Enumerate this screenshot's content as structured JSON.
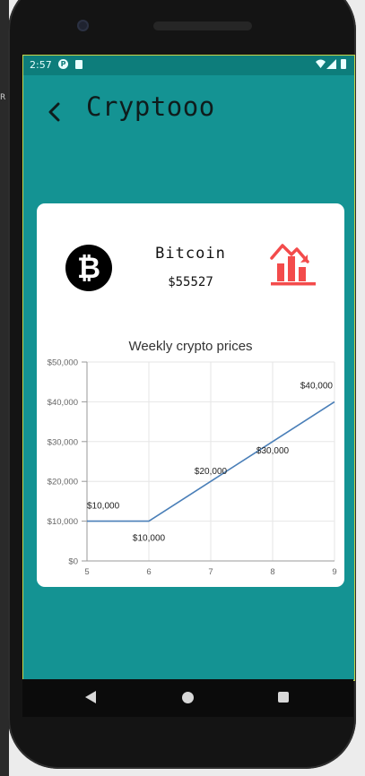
{
  "status_bar": {
    "time": "2:57"
  },
  "side_panel": {
    "truncated_text": "R"
  },
  "header": {
    "title": "Cryptooo"
  },
  "coin": {
    "name": "Bitcoin",
    "price": "$55527",
    "logo_symbol": "₿",
    "trend_icon": "chart-down-trend-icon",
    "trend_color": "#f34b4b"
  },
  "colors": {
    "app_background": "#149393",
    "status_bar": "#0d7d7b",
    "line": "#4a7fb8"
  },
  "chart_data": {
    "type": "line",
    "title": "Weekly crypto prices",
    "x": [
      5,
      6,
      7,
      8,
      9
    ],
    "x_ticks": [
      "5",
      "6",
      "7",
      "8",
      "9"
    ],
    "y_ticks": [
      "$0",
      "$10,000",
      "$20,000",
      "$30,000",
      "$40,000",
      "$50,000"
    ],
    "series": [
      {
        "values": [
          10000,
          10000,
          20000,
          30000,
          40000
        ],
        "data_labels": [
          "$10,000",
          "$10,000",
          "$20,000",
          "$30,000",
          "$40,000"
        ]
      }
    ],
    "xlim": [
      5,
      9
    ],
    "ylim": [
      0,
      50000
    ],
    "grid": true,
    "legend": "none"
  }
}
